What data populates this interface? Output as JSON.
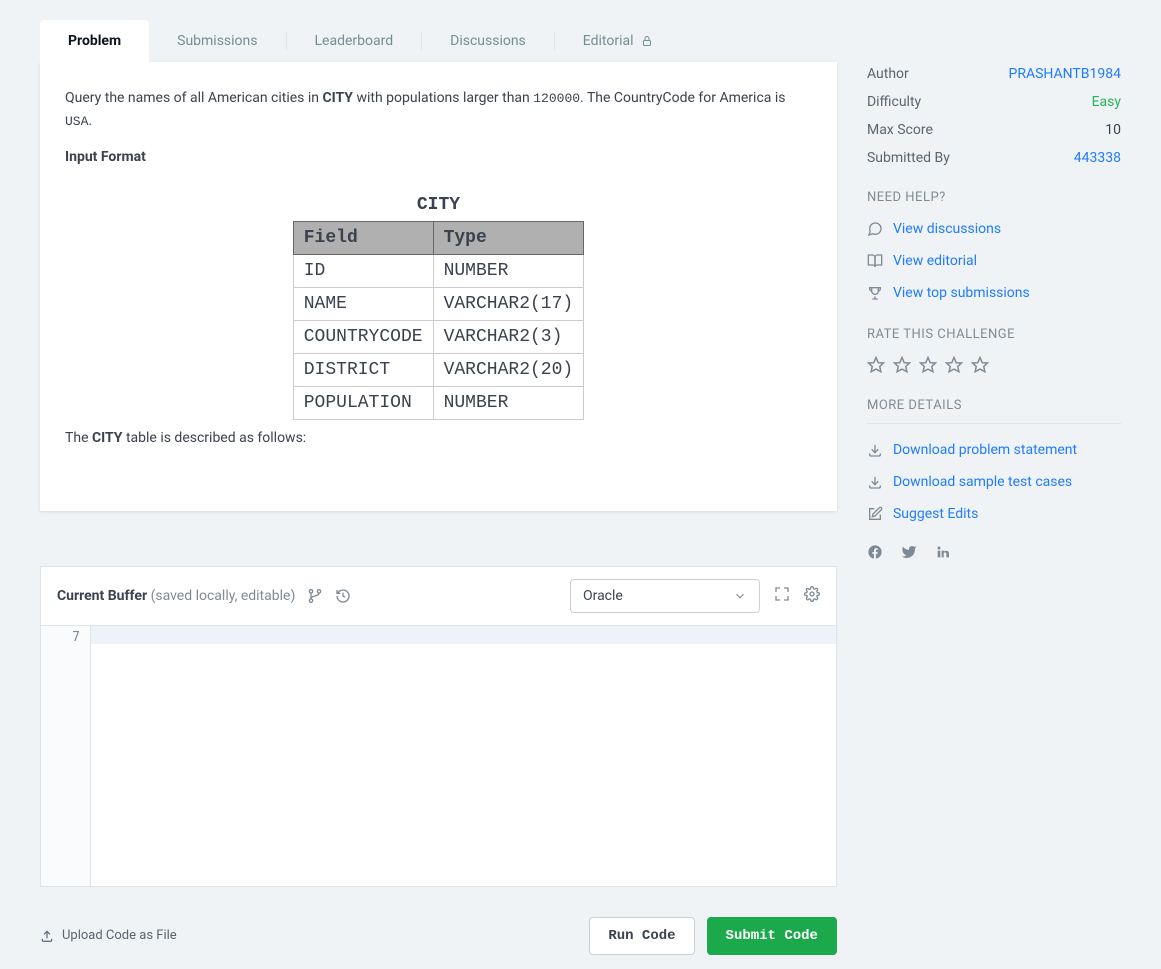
{
  "tabs": [
    "Problem",
    "Submissions",
    "Leaderboard",
    "Discussions",
    "Editorial"
  ],
  "problem": {
    "query_prefix": "Query the names of all American cities in ",
    "city_bold": "CITY",
    "query_mid1": " with populations larger than ",
    "pop_code": "120000",
    "query_mid2": ". The CountryCode for America is ",
    "usa_code": "USA",
    "period": ".",
    "input_format": "Input Format",
    "schema_title": "CITY",
    "schema_headers": [
      "Field",
      "Type"
    ],
    "schema_rows": [
      [
        "ID",
        "NUMBER"
      ],
      [
        "NAME",
        "VARCHAR2(17)"
      ],
      [
        "COUNTRYCODE",
        "VARCHAR2(3)"
      ],
      [
        "DISTRICT",
        "VARCHAR2(20)"
      ],
      [
        "POPULATION",
        "NUMBER"
      ]
    ],
    "desc_prefix": "The ",
    "desc_bold": "CITY",
    "desc_suffix": " table is described as follows:"
  },
  "info": {
    "author_label": "Author",
    "author_value": "PRASHANTB1984",
    "difficulty_label": "Difficulty",
    "difficulty_value": "Easy",
    "maxscore_label": "Max Score",
    "maxscore_value": "10",
    "submitted_label": "Submitted By",
    "submitted_value": "443338"
  },
  "help": {
    "heading": "NEED HELP?",
    "discussions": "View discussions",
    "editorial": "View editorial",
    "top": "View top submissions"
  },
  "rate_heading": "RATE THIS CHALLENGE",
  "more": {
    "heading": "MORE DETAILS",
    "dl_problem": "Download problem statement",
    "dl_tests": "Download sample test cases",
    "suggest": "Suggest Edits"
  },
  "editor": {
    "buffer_label": "Current Buffer",
    "buffer_sub": "(saved locally, editable)",
    "language": "Oracle",
    "line_no": "7"
  },
  "footer": {
    "upload": "Upload Code as File",
    "run": "Run Code",
    "submit": "Submit Code"
  }
}
